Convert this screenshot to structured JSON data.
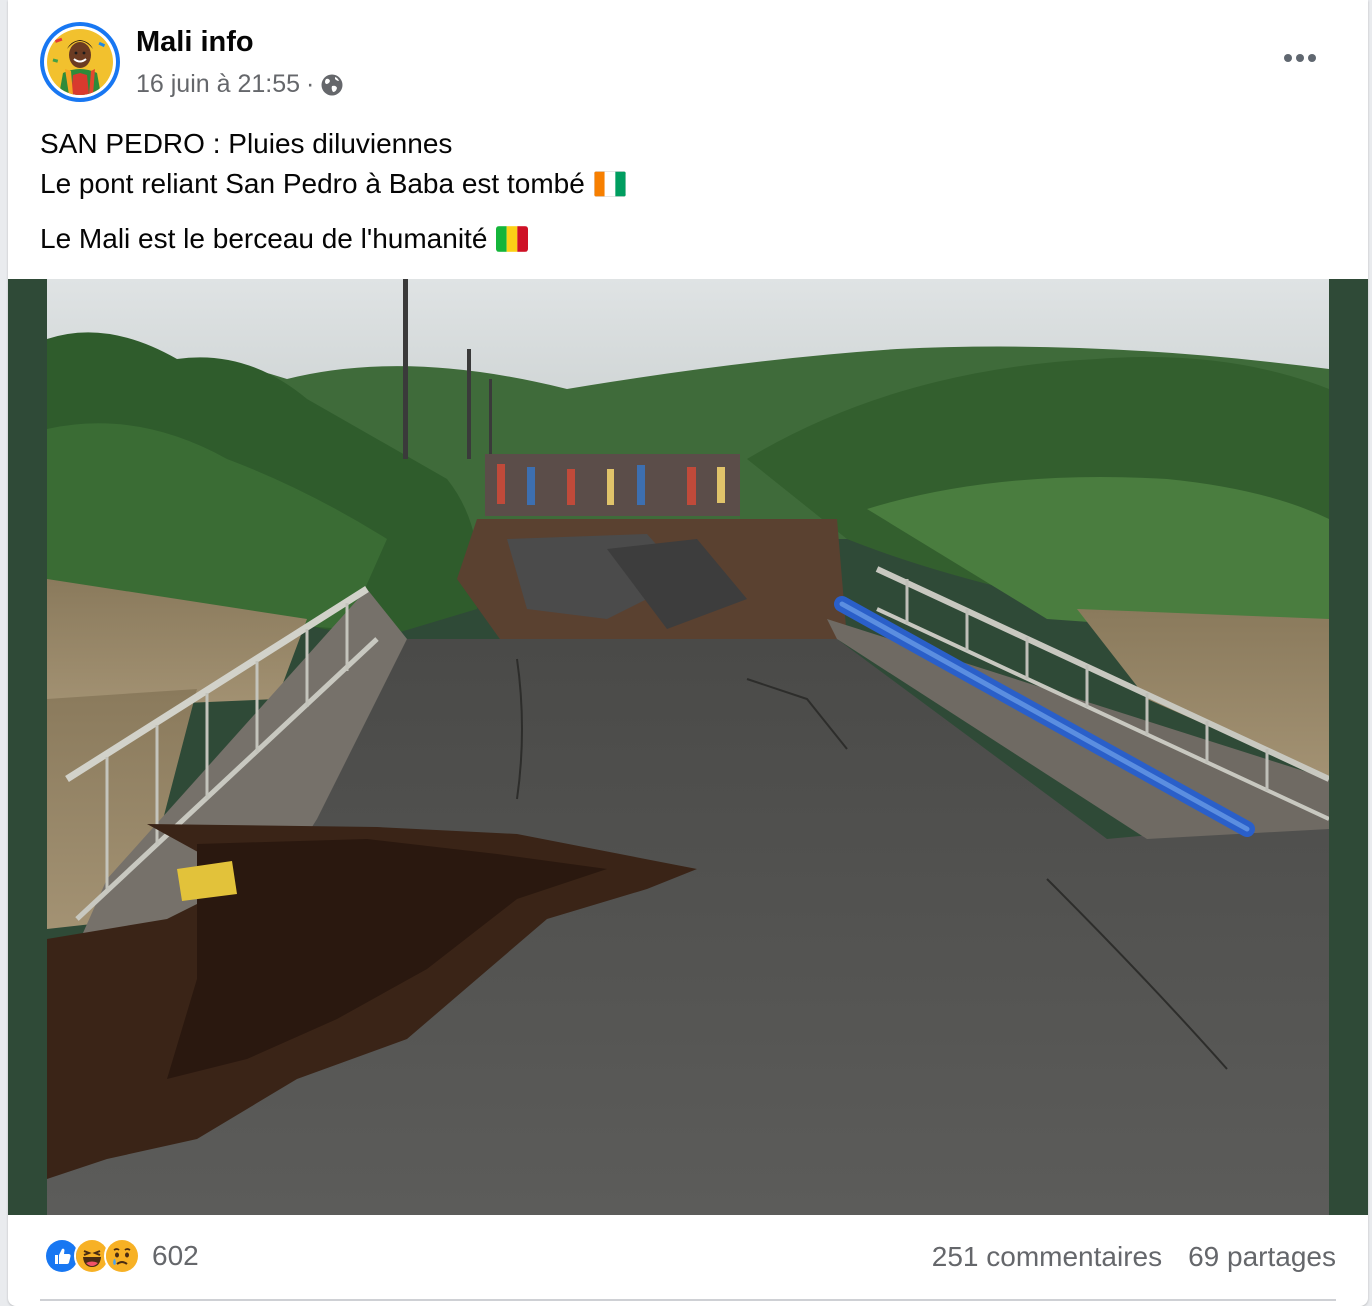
{
  "post": {
    "page_name": "Mali info",
    "timestamp": "16 juin à 21:55",
    "separator": "·",
    "audience_icon": "globe-icon",
    "more_icon": "more-options-icon",
    "text_lines": [
      "SAN PEDRO : Pluies diluviennes",
      "Le pont reliant San Pedro à Baba est tombé",
      "Le Mali est le berceau de l'humanité"
    ],
    "flags": [
      "ivory-coast-flag-icon",
      "mali-flag-icon"
    ]
  },
  "photo": {
    "subject": "collapsed-bridge-photo",
    "frame_color": "#2f4a37"
  },
  "footer": {
    "reaction_icons": [
      "like-icon",
      "haha-icon",
      "sad-icon"
    ],
    "reaction_count": "602",
    "comments": "251 commentaires",
    "shares": "69 partages"
  },
  "colors": {
    "brand_blue": "#1877f2",
    "secondary_text": "#65676b",
    "primary_text": "#050505"
  }
}
